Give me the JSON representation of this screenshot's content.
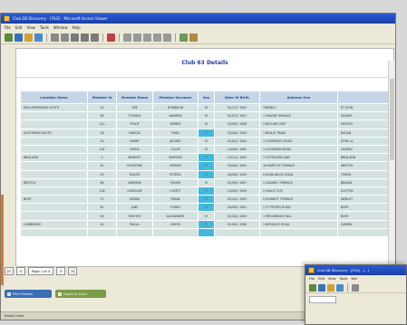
{
  "main_window": {
    "title": "Club DB Discovery - [FILE] - Microsoft Access Viewer",
    "menu": [
      "File",
      "Edit",
      "View",
      "Tools",
      "Window",
      "Help"
    ]
  },
  "report": {
    "title": "Club 63 Details",
    "columns": [
      "Location Name",
      "Member Id",
      "Member Name",
      "Member Surname",
      "Sex",
      "Date Of Birth",
      "Address One",
      ""
    ],
    "rows": [
      {
        "location": "ENGLISH/PHENIX SOUTH",
        "id": "22",
        "name": "ZEE",
        "surname": "ROBINSON",
        "sex": "M",
        "dob": "01/12/1 1904",
        "address": "TWEBELL",
        "extra": "ST JOHN",
        "hl": false
      },
      {
        "location": "",
        "id": "89",
        "name": "THOMAS",
        "surname": "WARREN",
        "sex": "M",
        "dob": "01/07/1 1951",
        "address": "1 CRAGIN TERRACE",
        "extra": "SELBUR",
        "hl": false
      },
      {
        "location": "",
        "id": "141",
        "name": "PHILIP",
        "surname": "WEBER",
        "sex": "M",
        "dob": "03/09/1 1908",
        "address": "3 BELLAIR CRAT",
        "extra": "HEYCRO",
        "hl": false
      },
      {
        "location": "SOUTHERN MOUTH",
        "id": "16",
        "name": "MARCIA",
        "surname": "RYAN",
        "sex": "F",
        "dob": "03/04/1 1904",
        "address": "1 BEALIE TRAVE",
        "extra": "RAGAN",
        "hl": true
      },
      {
        "location": "",
        "id": "34",
        "name": "HARRY",
        "surname": "JACOBS",
        "sex": "M",
        "dob": "01/02/1 1944",
        "address": "1 STOREFACE ROAD",
        "extra": "JOHN LA",
        "hl": false
      },
      {
        "location": "",
        "id": "105",
        "name": "DORIS",
        "surname": "COLES",
        "sex": "M",
        "dob": "10/09/1 1962",
        "address": "1 LOCKBURN ROAD",
        "extra": "LESDEN",
        "hl": false
      },
      {
        "location": "BRISLAND",
        "id": "3",
        "name": "BRIDGET",
        "surname": "SIMPSON",
        "sex": "F",
        "dob": "12/11/1 1903",
        "address": "7 COTTAGERS WAY",
        "extra": "BRISLAND",
        "hl": true
      },
      {
        "location": "",
        "id": "61",
        "name": "CHRISTINE",
        "surname": "MORRIS",
        "sex": "F",
        "dob": "03/08/1 1904",
        "address": "16 MARTLEY TERRACE",
        "extra": "WELTOR",
        "hl": true
      },
      {
        "location": "",
        "id": "93",
        "name": "TRACEY",
        "surname": "PETERS",
        "sex": "F",
        "dob": "04/08/1 1950",
        "address": "9 DOWLINGCE ROAD",
        "extra": "THERD",
        "hl": true
      },
      {
        "location": "BRISTOL",
        "id": "66",
        "name": "ANDREW",
        "surname": "FISHER",
        "sex": "M",
        "dob": "01/09/1 1907",
        "address": "1 DAGWEL TERRACE",
        "extra": "BRIAND",
        "hl": false
      },
      {
        "location": "",
        "id": "126",
        "name": "CAROLINE",
        "surname": "LOVETT",
        "sex": "F",
        "dob": "10/09/1 1909",
        "address": "2 HALLET STS",
        "extra": "CLIFTON",
        "hl": true
      },
      {
        "location": "BURY",
        "id": "51",
        "name": "DEBRA",
        "surname": "FRANK",
        "sex": "F",
        "dob": "01/04/1 1903",
        "address": "9 DOWBOT TERRACE",
        "extra": "WEBLEY",
        "hl": true
      },
      {
        "location": "",
        "id": "81",
        "name": "JANE",
        "surname": "FOWEY",
        "sex": "F",
        "dob": "04/09/1 1901",
        "address": "1 ST PETERS ROAD",
        "extra": "BURY",
        "hl": true
      },
      {
        "location": "",
        "id": "99",
        "name": "TIMOTHY",
        "surname": "ALEXANDER",
        "sex": "M",
        "dob": "01/04/1 1903",
        "address": "1 PROVIDENCE HILL",
        "extra": "BURY",
        "hl": false
      },
      {
        "location": "CAMBRIDGE",
        "id": "40",
        "name": "PAOLA",
        "surname": "GREER",
        "sex": "F",
        "dob": "01/09/1 1908",
        "address": "1 BERNICLE ROAD",
        "extra": "CAMBRI",
        "hl": true
      },
      {
        "location": "",
        "id": "",
        "name": "",
        "surname": "",
        "sex": "",
        "dob": "",
        "address": "",
        "extra": "",
        "hl": true
      }
    ]
  },
  "pager": {
    "first": "|<",
    "prev": "<",
    "info": "Page 1 of 3",
    "next": ">",
    "last": ">|"
  },
  "actions": {
    "print_label": "Print Preview",
    "export_label": "Export to Excel"
  },
  "statusbar": {
    "text": "Report view"
  },
  "second_window": {
    "title": "Club DB Discovery - [FILE] - [...]",
    "menu": [
      "File",
      "Edit",
      "View",
      "Tools",
      "Win"
    ]
  },
  "colors": {
    "title_blue": "#223a9a",
    "header_bg": "#c6d6e6",
    "cell_bg": "#d4e2e2",
    "highlight": "#42b8de",
    "titlebar": "#1a3fa8"
  }
}
